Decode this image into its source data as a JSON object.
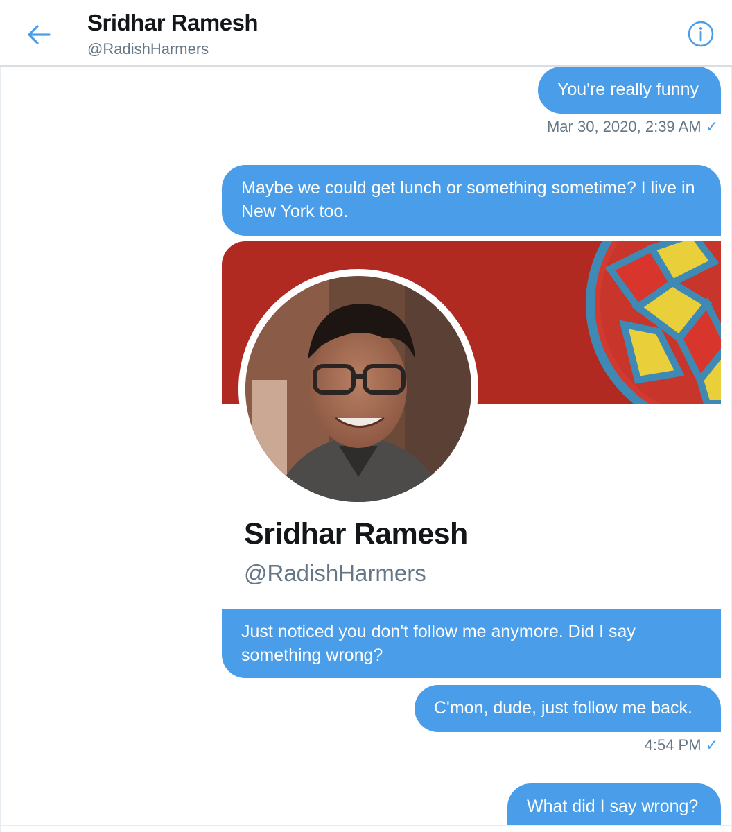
{
  "header": {
    "title": "Sridhar Ramesh",
    "handle": "@RadishHarmers"
  },
  "messages": [
    {
      "text": "You're really funny",
      "timestamp": "Mar 30, 2020, 2:39 AM"
    },
    {
      "text": "Maybe we could get lunch or something sometime? I live in New York too."
    },
    {
      "text": "Just noticed you don't follow me anymore. Did I say something wrong?"
    },
    {
      "text": "C'mon, dude, just follow me back.",
      "timestamp": "4:54 PM"
    },
    {
      "text": "What did I say wrong?"
    }
  ],
  "profile_card": {
    "name": "Sridhar Ramesh",
    "handle": "@RadishHarmers"
  },
  "colors": {
    "accent": "#4a9ee9",
    "banner": "#b12a22",
    "muted": "#657786"
  }
}
